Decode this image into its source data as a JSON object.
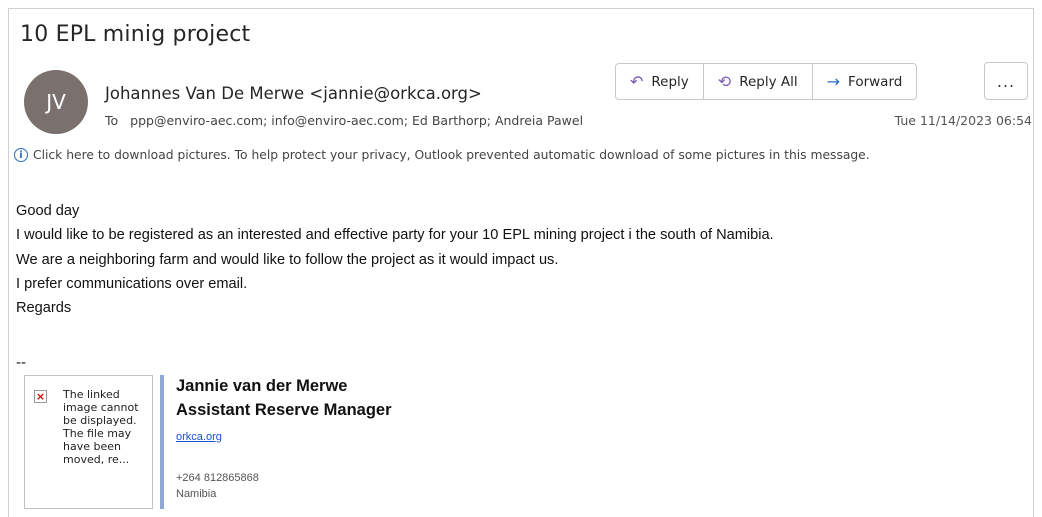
{
  "email": {
    "subject": "10 EPL minig project",
    "avatar_initials": "JV",
    "avatar_color": "#7a706d",
    "sender": "Johannes Van De Merwe <jannie@orkca.org>",
    "to_label": "To",
    "recipients": "ppp@enviro-aec.com; info@enviro-aec.com; Ed Barthorp; Andreia Pawel",
    "date": "Tue 11/14/2023 06:54",
    "info_bar": "Click here to download pictures. To help protect your privacy, Outlook prevented automatic download of some pictures in this message."
  },
  "actions": {
    "reply": "Reply",
    "reply_all": "Reply All",
    "forward": "Forward",
    "more": "..."
  },
  "body": {
    "lines": [
      "Good day",
      "I would like to be registered as an interested and effective party for your 10 EPL mining project i the south of Namibia.",
      "We are a neighboring farm and would like to follow the project as it would impact us.",
      "I prefer communications over email.",
      "Regards"
    ],
    "separator": "--"
  },
  "signature": {
    "broken_image_text": "The linked image cannot be displayed. The file may have been moved, re...",
    "name": "Jannie van der Merwe",
    "title": "Assistant Reserve Manager",
    "link": "orkca.org",
    "phone": "+264 812865868",
    "country": "Namibia"
  },
  "colors": {
    "accent_purple": "#7a5ab8",
    "accent_blue": "#2b6cc4",
    "signature_bar": "#8fa8d8",
    "link": "#1a4fd6"
  }
}
